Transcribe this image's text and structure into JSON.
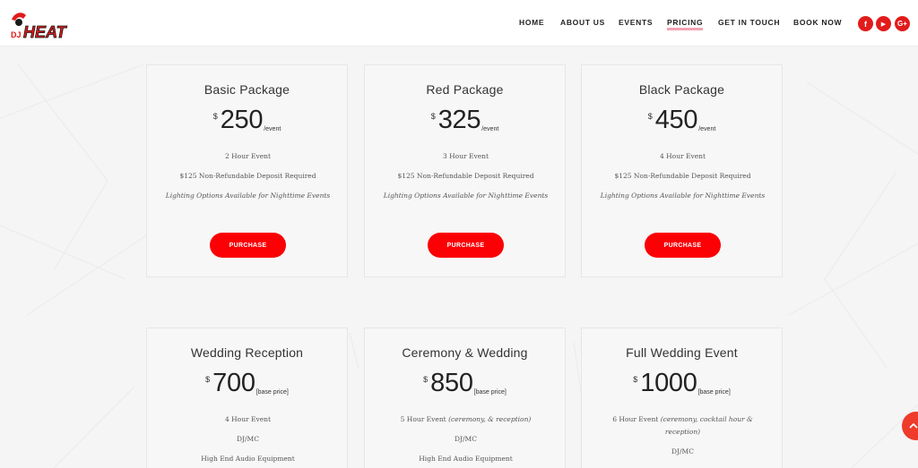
{
  "logo": {
    "text": "DJ HEAT"
  },
  "nav": {
    "items": [
      {
        "label": "HOME"
      },
      {
        "label": "ABOUT US"
      },
      {
        "label": "EVENTS"
      },
      {
        "label": "PRICING",
        "active": true
      },
      {
        "label": "GET IN TOUCH"
      },
      {
        "label": "BOOK NOW"
      }
    ]
  },
  "social": [
    {
      "icon": "facebook-icon",
      "glyph": "f"
    },
    {
      "icon": "youtube-icon",
      "glyph": "▶"
    },
    {
      "icon": "google-plus-icon",
      "glyph": "G+"
    }
  ],
  "packages": [
    {
      "title": "Basic Package",
      "currency": "$",
      "amount": "250",
      "unit": "/event",
      "features": [
        "2 Hour Event",
        "$125 Non-Refundable Deposit Required",
        "Lighting Options Available for Nighttime Events"
      ],
      "button": "PURCHASE"
    },
    {
      "title": "Red Package",
      "currency": "$",
      "amount": "325",
      "unit": "/event",
      "features": [
        "3 Hour Event",
        "$125 Non-Refundable Deposit Required",
        "Lighting Options Available for Nighttime Events"
      ],
      "button": "PURCHASE"
    },
    {
      "title": "Black Package",
      "currency": "$",
      "amount": "450",
      "unit": "/event",
      "features": [
        "4 Hour Event",
        "$125 Non-Refundable Deposit Required",
        "Lighting Options Available for Nighttime Events"
      ],
      "button": "PURCHASE"
    },
    {
      "title": "Wedding Reception",
      "currency": "$",
      "amount": "700",
      "unit": "[base price]",
      "features": [
        "4 Hour Event",
        "DJ/MC",
        "High End Audio Equipment"
      ]
    },
    {
      "title": "Ceremony & Wedding",
      "currency": "$",
      "amount": "850",
      "unit": "[base price]",
      "features": [
        "5 Hour Event",
        "(ceremony, & reception)",
        "DJ/MC",
        "High End Audio Equipment"
      ]
    },
    {
      "title": "Full Wedding Event",
      "currency": "$",
      "amount": "1000",
      "unit": "[base price]",
      "features": [
        "6 Hour Event",
        "(ceremony, cocktail hour & reception)",
        "DJ/MC"
      ]
    }
  ],
  "colors": {
    "accent": "#fb0005",
    "active_underline": "#f3a3b4",
    "scroll_top": "#ee3b2a"
  },
  "scroll_top": {
    "icon": "chevron-up-icon"
  }
}
